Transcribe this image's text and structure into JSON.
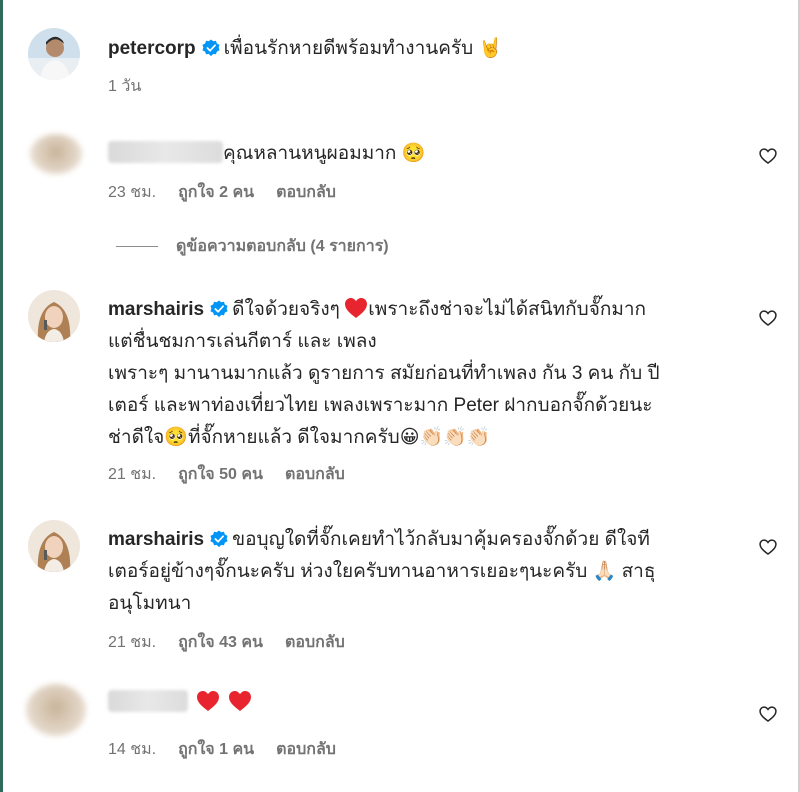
{
  "post": {
    "username": "petercorp",
    "caption": "เพื่อนรักหายดีพร้อมทำงานครับ 🤘",
    "time": "1 วัน"
  },
  "comments": [
    {
      "username": "",
      "text": "คุณหลานหนูผอมมาก 🥺",
      "time": "23 ชม.",
      "likes": "ถูกใจ 2 คน",
      "reply": "ตอบกลับ"
    },
    {
      "username": "marshairis",
      "line1": "ดีใจด้วยจริงๆ",
      "line1b": "เพราะถึงช่าจะไม่ได้สนิทกับจั๊กมาก",
      "line2": "แต่ชื่นชมการเล่นกีตาร์ และ เพลง",
      "line3": "เพราะๆ มานานมากแล้ว ดูรายการ สมัยก่อนที่ทำเพลง กัน 3 คน กับ ปี",
      "line4": "เตอร์ และพาท่องเที่ยวไทย เพลงเพราะมาก Peter ฝากบอกจั๊กด้วยนะ",
      "line5": "ช่าดีใจ🥺ที่จั๊กหายแล้ว ดีใจมากครับ😀👏🏻👏🏻👏🏻",
      "time": "21 ชม.",
      "likes": "ถูกใจ 50 คน",
      "reply": "ตอบกลับ"
    },
    {
      "username": "marshairis",
      "line1": "ขอบุญใดที่จั๊กเคยทำไว้กลับมาคุ้มครองจั๊กด้วย ดีใจที",
      "line2": "เตอร์อยู่ข้างๆจั๊กนะครับ ห่วงใยครับทานอาหารเยอะๆนะครับ 🙏🏻 สาธุ",
      "line3": "อนุโมทนา",
      "time": "21 ชม.",
      "likes": "ถูกใจ 43 คน",
      "reply": "ตอบกลับ"
    },
    {
      "username": "",
      "text": "",
      "time": "14 ชม.",
      "likes": "ถูกใจ 1 คน",
      "reply": "ตอบกลับ"
    }
  ],
  "view_replies": "ดูข้อความตอบกลับ (4 รายการ)",
  "icons": {
    "verified": "verified-badge-icon",
    "like": "heart-outline-icon",
    "heart": "red-heart-icon"
  },
  "colors": {
    "verified": "#0095f6",
    "heart": "#e8252e",
    "meta": "#737373",
    "text": "#262626"
  }
}
